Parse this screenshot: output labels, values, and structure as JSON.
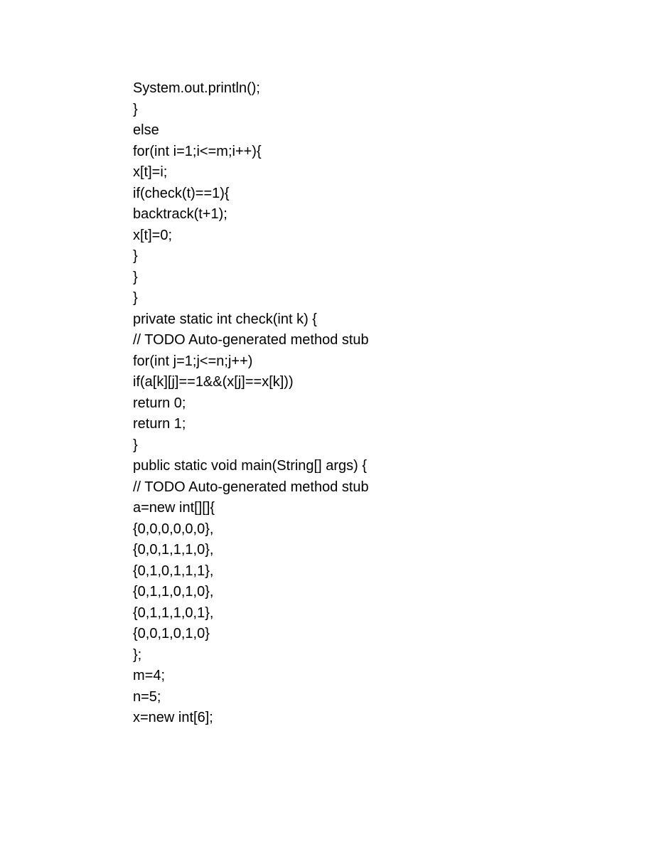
{
  "code": {
    "lines": [
      "System.out.println();",
      "}",
      "else",
      "for(int i=1;i<=m;i++){",
      "x[t]=i;",
      "if(check(t)==1){",
      "backtrack(t+1);",
      "x[t]=0;",
      "}",
      "}",
      "}",
      "private static int check(int k) {",
      "// TODO Auto-generated method stub",
      "for(int j=1;j<=n;j++)",
      "if(a[k][j]==1&&(x[j]==x[k]))",
      "return 0;",
      "return 1;",
      "}",
      "public static void main(String[] args) {",
      "// TODO Auto-generated method stub",
      "a=new int[][]{",
      "{0,0,0,0,0,0},",
      "{0,0,1,1,1,0},",
      "{0,1,0,1,1,1},",
      "{0,1,1,0,1,0},",
      "{0,1,1,1,0,1},",
      "{0,0,1,0,1,0}",
      "};",
      "m=4;",
      "n=5;",
      "x=new int[6];"
    ]
  }
}
